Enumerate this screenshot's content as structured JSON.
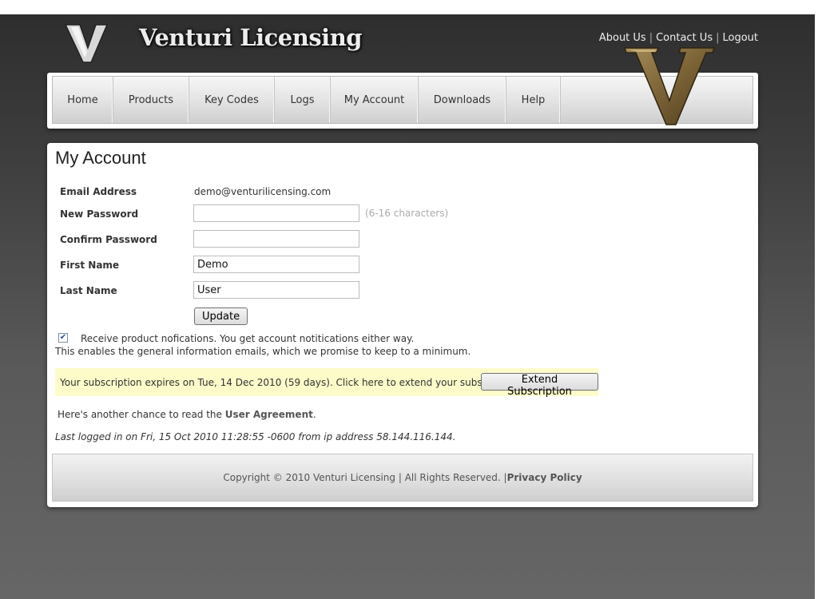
{
  "header": {
    "site_title": "Venturi Licensing",
    "links": {
      "about": "About Us",
      "contact": "Contact Us",
      "logout": "Logout",
      "separator": "|"
    },
    "logo_icon": "v-logo-icon"
  },
  "nav": {
    "items": [
      {
        "label": "Home"
      },
      {
        "label": "Products"
      },
      {
        "label": "Key Codes"
      },
      {
        "label": "Logs"
      },
      {
        "label": "My Account"
      },
      {
        "label": "Downloads"
      },
      {
        "label": "Help"
      }
    ]
  },
  "page": {
    "title": "My Account",
    "form": {
      "email_label": "Email Address",
      "email_value": "demo@venturilicensing.com",
      "new_password_label": "New Password",
      "new_password_value": "",
      "password_hint": "(6-16 characters)",
      "confirm_password_label": "Confirm Password",
      "confirm_password_value": "",
      "first_name_label": "First Name",
      "first_name_value": "Demo",
      "last_name_label": "Last Name",
      "last_name_value": "User",
      "update_button": "Update"
    },
    "notifications": {
      "checked": true,
      "label": "Receive product nofications. You get account notitications either way.",
      "sub": "This enables the general information emails, which we promise to keep to a minimum."
    },
    "subscription": {
      "text": "Your subscription expires on Tue, 14 Dec 2010 (59 days). Click here to extend your subscription.",
      "button": "Extend Subscription",
      "bg_color": "#fdfbc9"
    },
    "agreement": {
      "prefix": "Here's another chance to read the ",
      "link": "User Agreement",
      "suffix": "."
    },
    "last_login": "Last logged in on Fri, 15 Oct 2010 11:28:55 -0600 from ip address  58.144.116.144."
  },
  "footer": {
    "copyright": "Copyright © 2010 Venturi Licensing | All Rights Reserved. | ",
    "privacy": "Privacy Policy"
  }
}
